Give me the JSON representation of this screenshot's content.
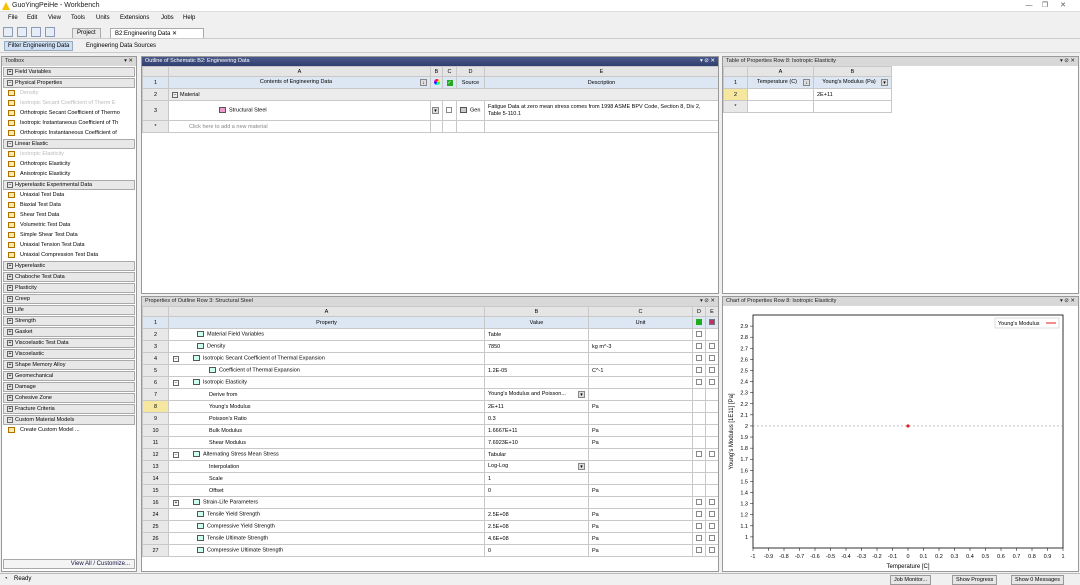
{
  "window": {
    "title": "GuoYingPeiHe - Workbench"
  },
  "menu": [
    "File",
    "Edit",
    "View",
    "Tools",
    "Units",
    "Extensions",
    "Jobs",
    "Help"
  ],
  "tabs": [
    {
      "label": "Project"
    },
    {
      "label": "B2:Engineering Data"
    }
  ],
  "subtool": {
    "filter": "Filter Engineering Data",
    "sources": "Engineering Data Sources"
  },
  "toolbox": {
    "title": "Toolbox",
    "sections": [
      {
        "name": "Field Variables",
        "items": []
      },
      {
        "name": "Physical Properties",
        "items": [
          {
            "label": "Density",
            "disabled": true
          },
          {
            "label": "Isotropic Secant Coefficient of Therm E",
            "disabled": true
          },
          {
            "label": "Orthotropic Secant Coefficient of Thermo",
            "disabled": false
          },
          {
            "label": "Isotropic Instantaneous Coefficient of Th",
            "disabled": false
          },
          {
            "label": "Orthotropic Instantaneous Coefficient of",
            "disabled": false
          }
        ]
      },
      {
        "name": "Linear Elastic",
        "items": [
          {
            "label": "Isotropic Elasticity",
            "disabled": true
          },
          {
            "label": "Orthotropic Elasticity",
            "disabled": false
          },
          {
            "label": "Anisotropic Elasticity",
            "disabled": false
          }
        ]
      },
      {
        "name": "Hyperelastic Experimental Data",
        "items": [
          {
            "label": "Uniaxial Test Data",
            "disabled": false
          },
          {
            "label": "Biaxial Test Data",
            "disabled": false
          },
          {
            "label": "Shear Test Data",
            "disabled": false
          },
          {
            "label": "Volumetric Test Data",
            "disabled": false
          },
          {
            "label": "Simple Shear Test Data",
            "disabled": false
          },
          {
            "label": "Uniaxial Tension Test Data",
            "disabled": false
          },
          {
            "label": "Uniaxial Compression Test Data",
            "disabled": false
          }
        ]
      },
      {
        "name": "Hyperelastic",
        "items": []
      },
      {
        "name": "Chaboche Test Data",
        "items": []
      },
      {
        "name": "Plasticity",
        "items": []
      },
      {
        "name": "Creep",
        "items": []
      },
      {
        "name": "Life",
        "items": []
      },
      {
        "name": "Strength",
        "items": []
      },
      {
        "name": "Gasket",
        "items": []
      },
      {
        "name": "Viscoelastic Test Data",
        "items": []
      },
      {
        "name": "Viscoelastic",
        "items": []
      },
      {
        "name": "Shape Memory Alloy",
        "items": []
      },
      {
        "name": "Geomechanical",
        "items": []
      },
      {
        "name": "Damage",
        "items": []
      },
      {
        "name": "Cohesive Zone",
        "items": []
      },
      {
        "name": "Fracture Criteria",
        "items": []
      },
      {
        "name": "Custom Material Models",
        "items": [
          {
            "label": "Create Custom Model ...",
            "disabled": false
          }
        ]
      }
    ],
    "footer": "View All / Customize..."
  },
  "outline": {
    "title": "Outline of Schematic B2: Engineering Data",
    "cols": [
      "A",
      "B",
      "C",
      "D",
      "E"
    ],
    "headers": [
      "Contents of Engineering Data",
      "",
      "",
      "Source",
      "Description"
    ],
    "section": "Material",
    "material": "Structural Steel",
    "source": "Gen",
    "description": "Fatigue Data at zero mean stress comes from 1998 ASME BPV Code, Section 8, Div 2, Table 5-110.1",
    "add": "Click here to add a new material"
  },
  "tableprops": {
    "title": "Table of Properties Row 8: Isotropic Elasticity",
    "cols": [
      "A",
      "B"
    ],
    "headers": [
      "Temperature (C)",
      "Young's Modulus (Pa)"
    ],
    "value": "2E+11"
  },
  "props": {
    "title": "Properties of Outline Row 3: Structural Steel",
    "cols": [
      "A",
      "B",
      "C",
      "D",
      "E"
    ],
    "headers": [
      "Property",
      "Value",
      "Unit"
    ],
    "rows": [
      {
        "n": "2",
        "p": "Material Field Variables",
        "v": "Table",
        "u": "",
        "indent": 0,
        "icon": true,
        "tog": ""
      },
      {
        "n": "3",
        "p": "Density",
        "v": "7850",
        "u": "kg m^-3",
        "indent": 0,
        "icon": true,
        "tog": ""
      },
      {
        "n": "4",
        "p": "Isotropic Secant Coefficient of Thermal Expansion",
        "v": "",
        "u": "",
        "indent": 0,
        "icon": true,
        "tog": "−"
      },
      {
        "n": "5",
        "p": "Coefficient of Thermal Expansion",
        "v": "1.2E-05",
        "u": "C^-1",
        "indent": 1,
        "icon": true,
        "tog": ""
      },
      {
        "n": "6",
        "p": "Isotropic Elasticity",
        "v": "",
        "u": "",
        "indent": 0,
        "icon": true,
        "tog": "−"
      },
      {
        "n": "7",
        "p": "Derive from",
        "v": "Young's Modulus and Poisson...",
        "u": "",
        "indent": 1,
        "icon": false,
        "tog": "",
        "dd": true
      },
      {
        "n": "8",
        "p": "Young's Modulus",
        "v": "2E+11",
        "u": "Pa",
        "indent": 1,
        "icon": false,
        "tog": ""
      },
      {
        "n": "9",
        "p": "Poisson's Ratio",
        "v": "0.3",
        "u": "",
        "indent": 1,
        "icon": false,
        "tog": ""
      },
      {
        "n": "10",
        "p": "Bulk Modulus",
        "v": "1.6667E+11",
        "u": "Pa",
        "indent": 1,
        "icon": false,
        "tog": ""
      },
      {
        "n": "11",
        "p": "Shear Modulus",
        "v": "7.6923E+10",
        "u": "Pa",
        "indent": 1,
        "icon": false,
        "tog": ""
      },
      {
        "n": "12",
        "p": "Alternating Stress Mean Stress",
        "v": "Tabular",
        "u": "",
        "indent": 0,
        "icon": true,
        "tog": "−"
      },
      {
        "n": "13",
        "p": "Interpolation",
        "v": "Log-Log",
        "u": "",
        "indent": 1,
        "icon": false,
        "tog": "",
        "dd": true
      },
      {
        "n": "14",
        "p": "Scale",
        "v": "1",
        "u": "",
        "indent": 1,
        "icon": false,
        "tog": ""
      },
      {
        "n": "15",
        "p": "Offset",
        "v": "0",
        "u": "Pa",
        "indent": 1,
        "icon": false,
        "tog": ""
      },
      {
        "n": "16",
        "p": "Strain-Life Parameters",
        "v": "",
        "u": "",
        "indent": 0,
        "icon": true,
        "tog": "+"
      },
      {
        "n": "24",
        "p": "Tensile Yield Strength",
        "v": "2.5E+08",
        "u": "Pa",
        "indent": 0,
        "icon": true,
        "tog": ""
      },
      {
        "n": "25",
        "p": "Compressive Yield Strength",
        "v": "2.5E+08",
        "u": "Pa",
        "indent": 0,
        "icon": true,
        "tog": ""
      },
      {
        "n": "26",
        "p": "Tensile Ultimate Strength",
        "v": "4.6E+08",
        "u": "Pa",
        "indent": 0,
        "icon": true,
        "tog": ""
      },
      {
        "n": "27",
        "p": "Compressive Ultimate Strength",
        "v": "0",
        "u": "Pa",
        "indent": 0,
        "icon": true,
        "tog": ""
      }
    ]
  },
  "chart": {
    "title": "Chart of Properties Row 8: Isotropic Elasticity",
    "legend": "Young's Modulus",
    "xlabel": "Temperature [C]",
    "ylabel": "Young's Modulus [1E11] [Pa]",
    "xticks": [
      "-1",
      "-0.9",
      "-0.8",
      "-0.7",
      "-0.6",
      "-0.5",
      "-0.4",
      "-0.3",
      "-0.2",
      "-0.1",
      "0",
      "0.1",
      "0.2",
      "0.3",
      "0.4",
      "0.5",
      "0.6",
      "0.7",
      "0.8",
      "0.9",
      "1"
    ],
    "yticks": [
      "1",
      "1.1",
      "1.2",
      "1.3",
      "1.4",
      "1.5",
      "1.6",
      "1.7",
      "1.8",
      "1.9",
      "2",
      "2.1",
      "2.2",
      "2.3",
      "2.4",
      "2.5",
      "2.6",
      "2.7",
      "2.8",
      "2.9"
    ],
    "accent": "#e02020"
  },
  "chart_data": {
    "type": "scatter",
    "series": [
      {
        "name": "Young's Modulus",
        "x": [
          0
        ],
        "y": [
          2
        ]
      }
    ],
    "xlim": [
      -1,
      1
    ],
    "ylim": [
      1,
      2.9
    ],
    "xlabel": "Temperature [C]",
    "ylabel": "Young's Modulus [1E11] [Pa]",
    "title": "Chart of Properties Row 8: Isotropic Elasticity",
    "grid": true,
    "legend": "top-right"
  },
  "status": {
    "ready": "Ready",
    "job": "Job Monitor...",
    "progress": "Show Progress",
    "messages": "Show 0 Messages"
  }
}
